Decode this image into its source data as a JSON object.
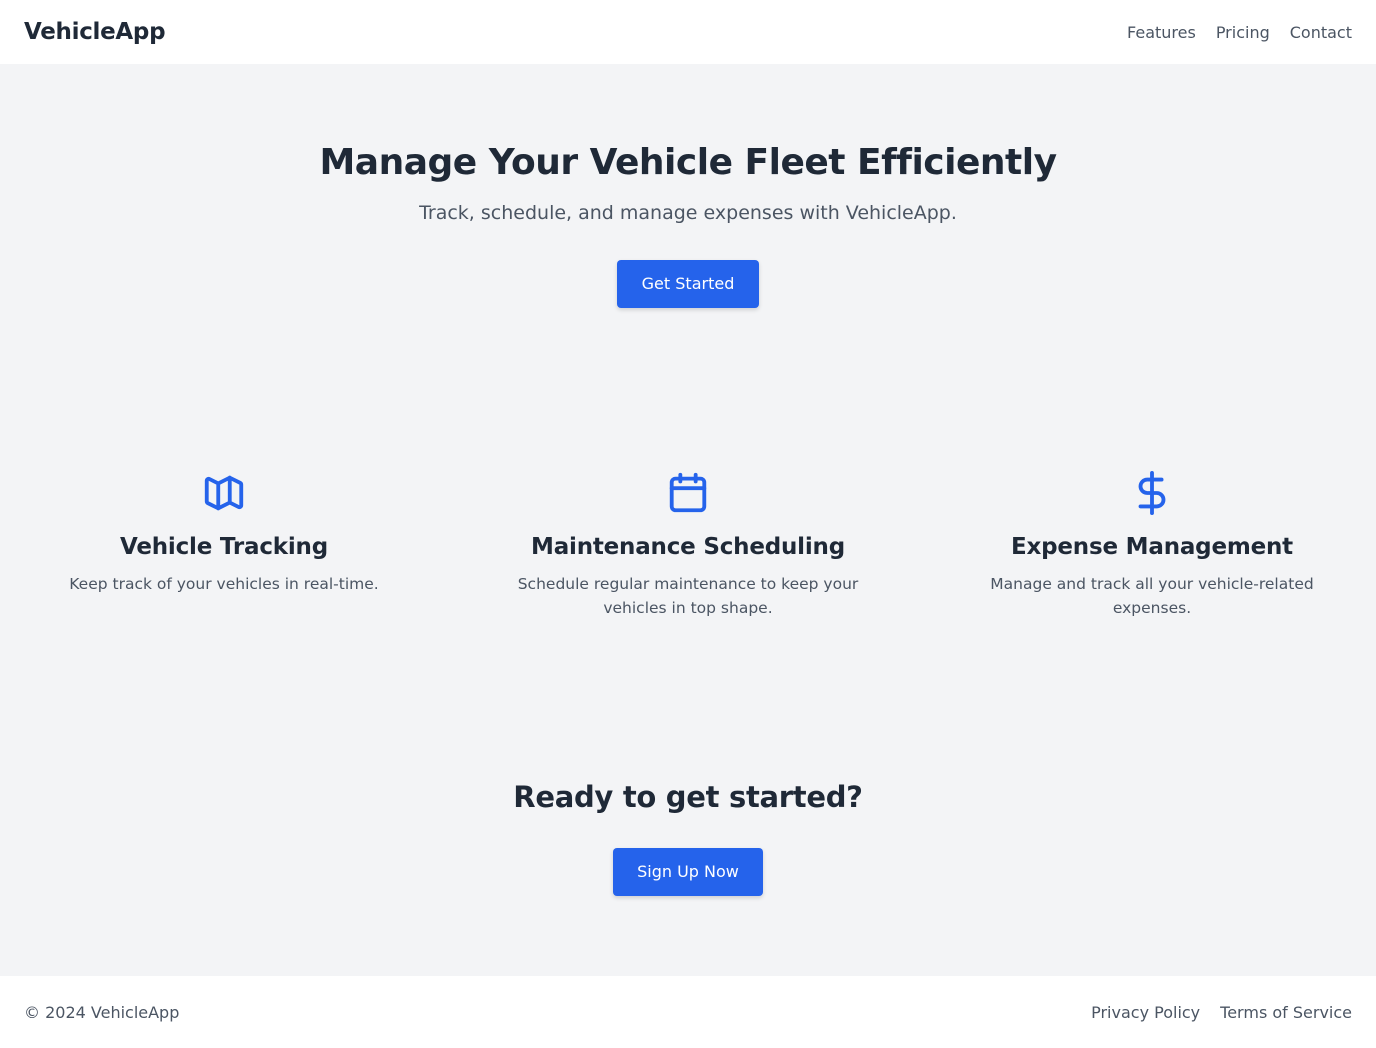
{
  "header": {
    "brand": "VehicleApp",
    "nav": [
      "Features",
      "Pricing",
      "Contact"
    ]
  },
  "hero": {
    "title": "Manage Your Vehicle Fleet Efficiently",
    "subtitle": "Track, schedule, and manage expenses with VehicleApp.",
    "button_label": "Get Started"
  },
  "features": [
    {
      "icon": "map-icon",
      "title": "Vehicle Tracking",
      "description": "Keep track of your vehicles in real-time."
    },
    {
      "icon": "calendar-icon",
      "title": "Maintenance Scheduling",
      "description": "Schedule regular maintenance to keep your vehicles in top shape."
    },
    {
      "icon": "dollar-icon",
      "title": "Expense Management",
      "description": "Manage and track all your vehicle-related expenses."
    }
  ],
  "cta": {
    "title": "Ready to get started?",
    "button_label": "Sign Up Now"
  },
  "footer": {
    "copyright": "© 2024 VehicleApp",
    "links": [
      "Privacy Policy",
      "Terms of Service"
    ]
  },
  "colors": {
    "accent": "#2563eb",
    "background": "#f3f4f6",
    "surface": "#ffffff",
    "heading": "#1f2937",
    "body_text": "#4b5563"
  }
}
